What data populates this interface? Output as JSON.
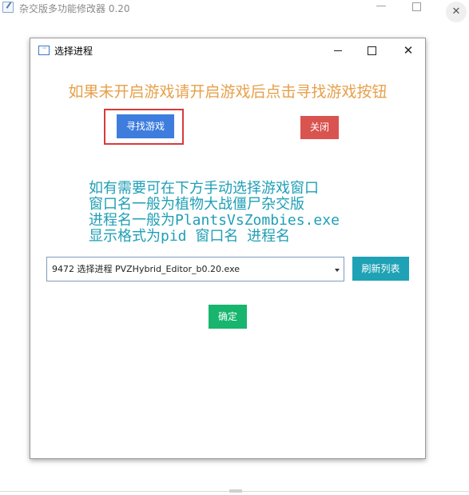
{
  "background_window": {
    "title": "杂交版多功能修改器  0.20",
    "icons": [
      "app-edit-icon",
      "minimize-icon",
      "maximize-icon",
      "close-icon"
    ],
    "min_glyph": "—",
    "close_glyph": "✕"
  },
  "dialog": {
    "title": "选择进程",
    "icons": [
      "window-dots-icon",
      "minimize-icon",
      "maximize-icon",
      "close-icon"
    ],
    "icon_glyph": "···",
    "close_glyph": "✕",
    "headline": "如果未开启游戏请开启游戏后点击寻找游戏按钮",
    "find_button_label": "寻找游戏",
    "close_button_label": "关闭",
    "info_lines": [
      "如有需要可在下方手动选择游戏窗口",
      "窗口名一般为植物大战僵尸杂交版",
      "进程名一般为PlantsVsZombies.exe",
      "显示格式为pid 窗口名 进程名"
    ],
    "process_select": {
      "selected": "9472 选择进程 PVZHybrid_Editor_b0.20.exe"
    },
    "refresh_button_label": "刷新列表",
    "ok_button_label": "确定"
  },
  "colors": {
    "headline": "#e6a04a",
    "info_text": "#1f9fb6",
    "find_button": "#3e7dde",
    "close_button": "#d9534f",
    "refresh_button": "#1fa2b5",
    "ok_button": "#17b56e",
    "highlight_border": "#d83a3a"
  }
}
